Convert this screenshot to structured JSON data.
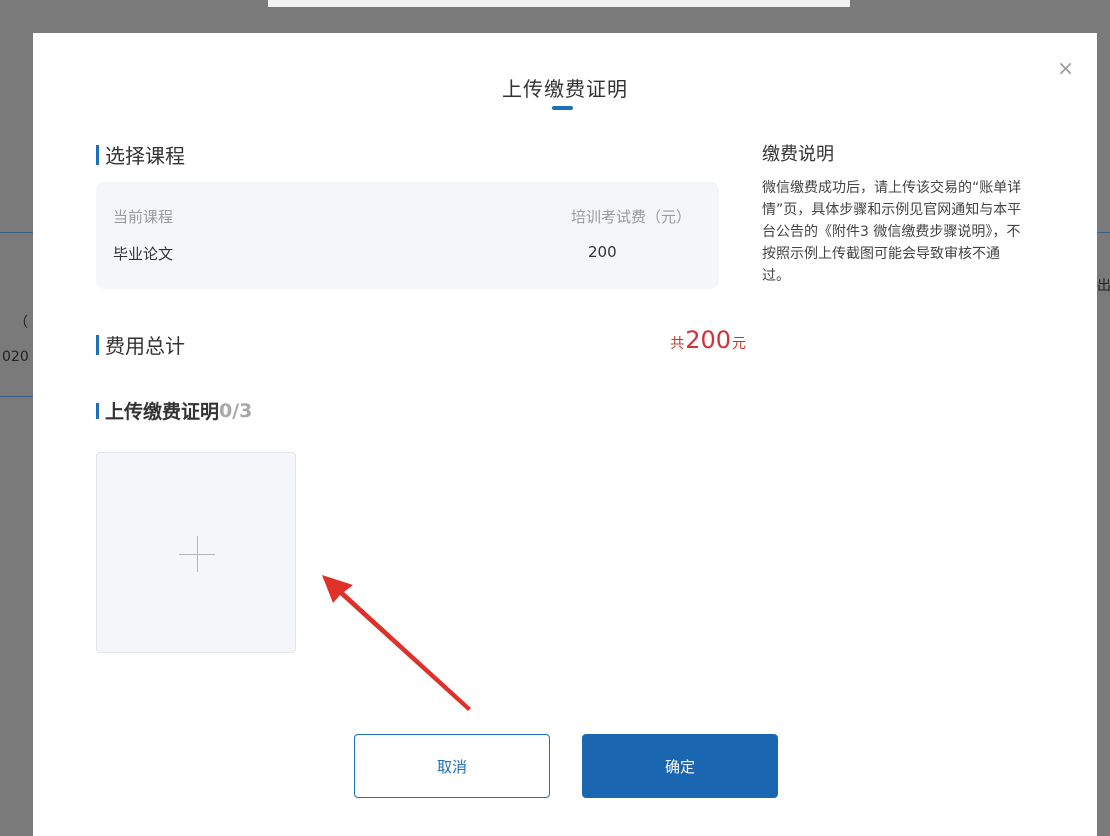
{
  "background": {
    "left_text_1": "（",
    "left_text_2": "020",
    "right_text": "出"
  },
  "modal": {
    "title": "上传缴费证明",
    "close_icon": "×",
    "select_course_heading": "选择课程",
    "course_table": {
      "col_course_label": "当前课程",
      "col_fee_label": "培训考试费（元）",
      "course_name": "毕业论文",
      "fee_value": "200"
    },
    "total_heading": "费用总计",
    "total_prefix": "共",
    "total_amount": "200",
    "total_suffix": "元",
    "upload_heading": "上传缴费证明",
    "upload_count": "0/3",
    "upload_icon": "plus-icon",
    "notes": {
      "title": "缴费说明",
      "text": "微信缴费成功后，请上传该交易的“账单详情”页，具体步骤和示例见官网通知与本平台公告的《附件3 微信缴费步骤说明》，不按照示例上传截图可能会导致审核不通过。"
    },
    "buttons": {
      "cancel": "取消",
      "confirm": "确定"
    }
  },
  "colors": {
    "accent": "#1f6fb8",
    "price": "#d0323a",
    "arrow": "#e0302a"
  }
}
